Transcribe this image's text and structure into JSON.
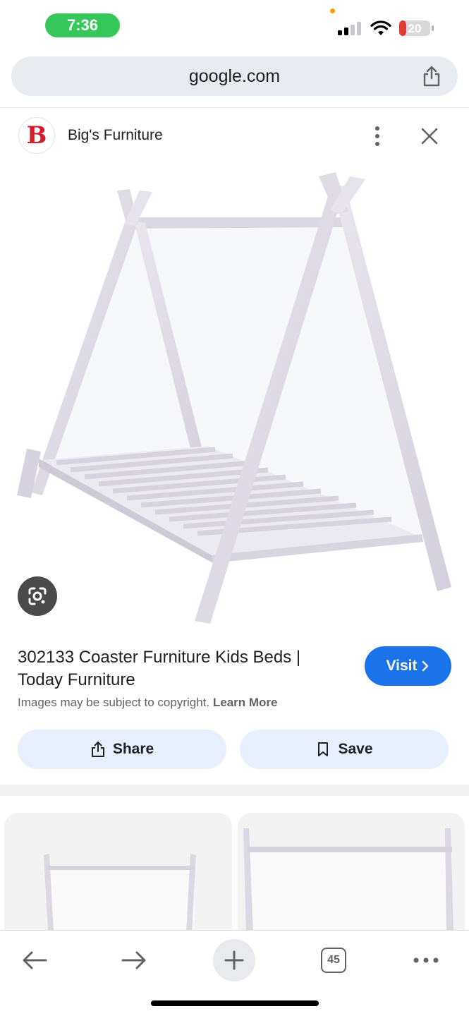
{
  "status_bar": {
    "time": "7:36",
    "battery_level": "20",
    "icons": [
      "signal-icon",
      "wifi-icon",
      "battery-icon"
    ]
  },
  "browser": {
    "url": "google.com",
    "share_icon": "share-icon"
  },
  "source": {
    "logo_letter": "B",
    "name": "Big's Furniture",
    "brand_color": "#d01f2b"
  },
  "result": {
    "title": "302133 Coaster Furniture Kids Beds | Today Furniture",
    "visit_label": "Visit",
    "copyright_text": "Images may be subject to copyright.",
    "learn_more": "Learn More",
    "share_label": "Share",
    "save_label": "Save"
  },
  "toolbar": {
    "tabs_count": "45"
  },
  "colors": {
    "accent": "#1a73e8",
    "status_green": "#35c759",
    "action_bg": "#e8f0fe"
  }
}
